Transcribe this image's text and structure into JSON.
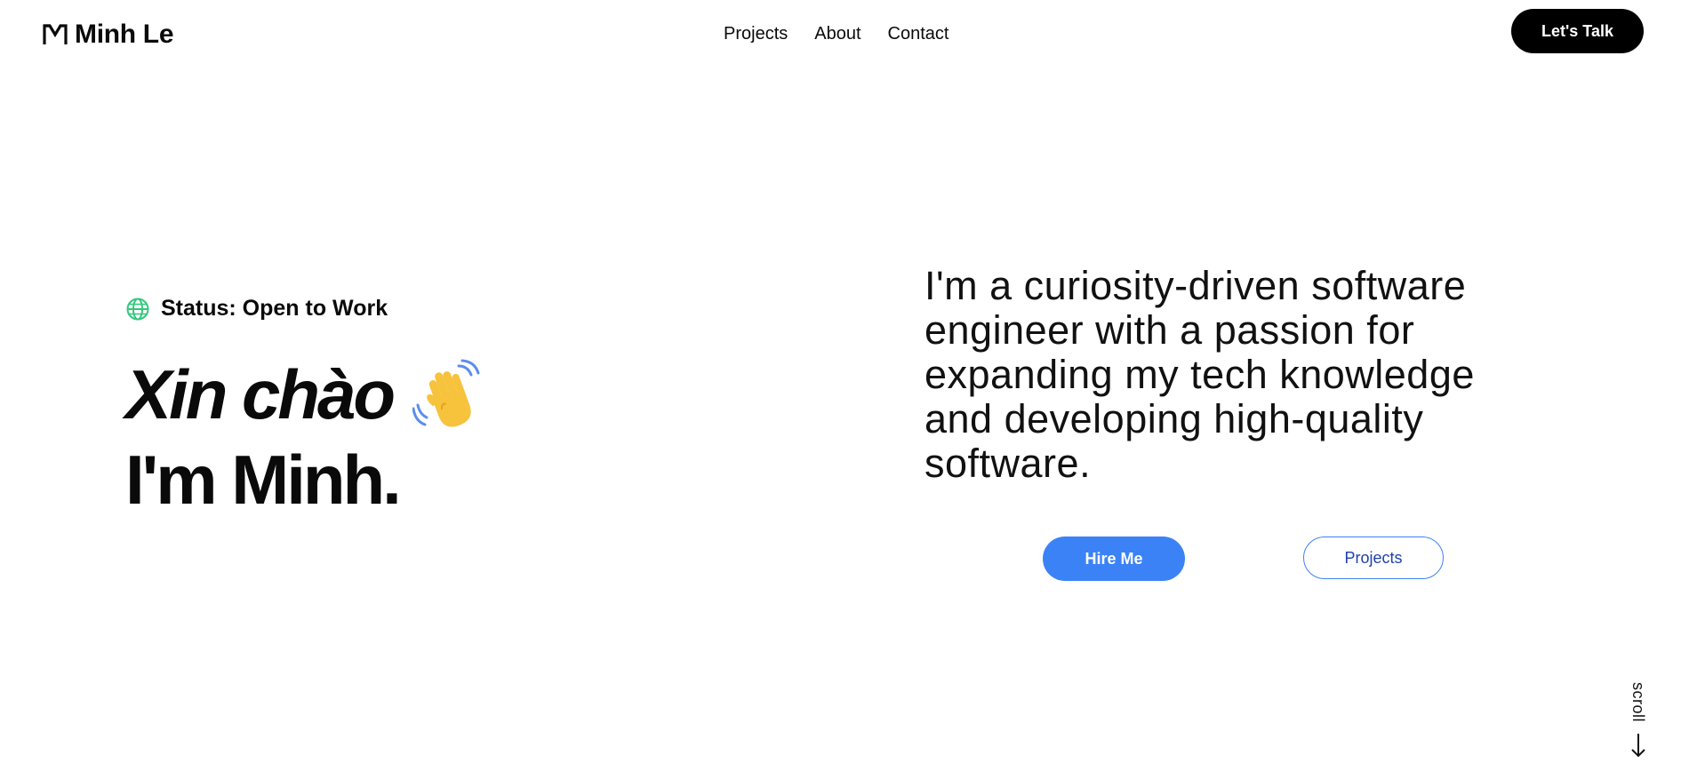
{
  "header": {
    "logo_text": "Minh Le",
    "logo_icon": "m-logo-icon",
    "nav": [
      {
        "label": "Projects"
      },
      {
        "label": "About"
      },
      {
        "label": "Contact"
      }
    ],
    "cta_label": "Let's Talk"
  },
  "hero": {
    "status_icon": "globe-icon",
    "status_text": "Status: Open to Work",
    "greeting": "Xin chào",
    "greeting_icon": "waving-hand-icon",
    "name_line": "I'm Minh.",
    "intro": "I'm a curiosity-driven software engineer with a passion for expanding my tech knowledge and developing high-quality software.",
    "primary_button": "Hire Me",
    "secondary_button": "Projects"
  },
  "scroll": {
    "label": "scroll",
    "icon": "arrow-down-icon"
  },
  "colors": {
    "accent": "#3b82f6",
    "accent_dark": "#1e40af",
    "status_green": "#34c77b",
    "text": "#0a0a0a",
    "cta_bg": "#000000",
    "background": "#ffffff"
  }
}
